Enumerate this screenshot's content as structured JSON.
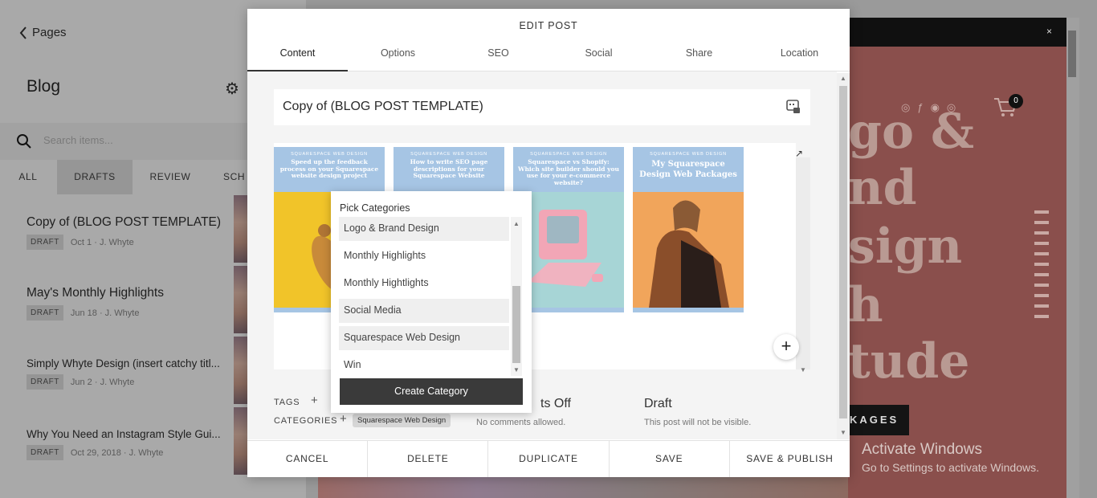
{
  "left_panel": {
    "back_label": "Pages",
    "title": "Blog",
    "search_placeholder": "Search items...",
    "filters": [
      "ALL",
      "DRAFTS",
      "REVIEW",
      "SCH"
    ],
    "active_filter": "DRAFTS",
    "posts": [
      {
        "title": "Copy of (BLOG POST TEMPLATE)",
        "status": "DRAFT",
        "date": "Oct 1",
        "author": "J. Whyte"
      },
      {
        "title": "May's Monthly Highlights",
        "status": "DRAFT",
        "date": "Jun 18",
        "author": "J. Whyte"
      },
      {
        "title": "Simply Whyte Design (insert catchy titl...",
        "status": "DRAFT",
        "date": "Jun 2",
        "author": "J. Whyte"
      },
      {
        "title": "Why You Need an Instagram Style Gui...",
        "status": "DRAFT",
        "date": "Oct 29, 2018",
        "author": "J. Whyte"
      }
    ],
    "meta_separator": "·"
  },
  "modal": {
    "title": "EDIT POST",
    "tabs": [
      "Content",
      "Options",
      "SEO",
      "Social",
      "Share",
      "Location"
    ],
    "active_tab": "Content",
    "post_title": "Copy of (BLOG POST TEMPLATE)",
    "gallery": [
      {
        "brand": "SQUARESPACE WEB DESIGN",
        "headline": "Speed up the feedback process on your Squarespace website design project"
      },
      {
        "brand": "SQUARESPACE WEB DESIGN",
        "headline": "How to write SEO page descriptions for your Squarespace Website"
      },
      {
        "brand": "SQUARESPACE WEB DESIGN",
        "headline": "Squarespace vs Shopify: Which site builder should you use for your e-commerce website?"
      },
      {
        "brand": "SQUARESPACE WEB DESIGN",
        "headline": "My Squarespace Design Web Packages"
      }
    ],
    "tags_label": "TAGS",
    "categories_label": "CATEGORIES",
    "category_chip": "Squarespace Web Design",
    "comments_heading": "ts Off",
    "comments_sub": "No comments allowed.",
    "status_heading": "Draft",
    "status_sub": "This post will not be visible.",
    "footer_buttons": [
      "CANCEL",
      "DELETE",
      "DUPLICATE",
      "SAVE",
      "SAVE & PUBLISH"
    ]
  },
  "category_popup": {
    "heading": "Pick Categories",
    "options": [
      "Logo & Brand Design",
      "Monthly Highlights",
      "Monthly Hightlights",
      "Social Media",
      "Squarespace Web Design",
      "Win"
    ],
    "highlighted": [
      "Logo & Brand Design",
      "Social Media",
      "Squarespace Web Design"
    ],
    "create_label": "Create Category"
  },
  "preview": {
    "close": "×",
    "hero_lines": [
      "go &",
      "nd",
      "sign",
      "h",
      "tude"
    ],
    "cart_count": "0",
    "packages_btn": "KAGES",
    "activate_title": "Activate Windows",
    "activate_sub": "Go to Settings to activate Windows."
  },
  "colors": {
    "preview_bg": "#8a4f4c",
    "card_header": "#a6c5e4",
    "create_btn": "#3a3a3a"
  }
}
